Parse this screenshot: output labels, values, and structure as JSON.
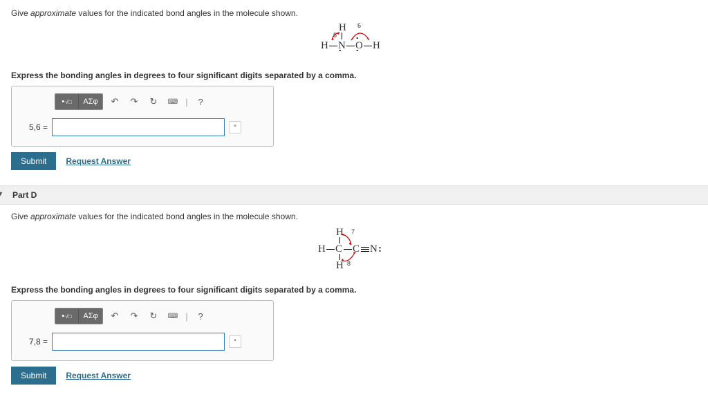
{
  "partC": {
    "instruction_prefix": "Give ",
    "instruction_em": "approximate",
    "instruction_suffix": " values for the indicated bond angles in the molecule shown.",
    "express": "Express the bonding angles in degrees to four significant digits separated by a comma.",
    "var_label": "5,6 =",
    "molecule": {
      "label5": "5",
      "label6": "6"
    }
  },
  "partD": {
    "header": "Part D",
    "instruction_prefix": "Give ",
    "instruction_em": "approximate",
    "instruction_suffix": " values for the indicated bond angles in the molecule shown.",
    "express": "Express the bonding angles in degrees to four significant digits separated by a comma.",
    "var_label": "7,8 =",
    "molecule": {
      "label7": "7",
      "label8": "8"
    }
  },
  "toolbar": {
    "templates_icon": "▪",
    "sqrt_icon": "√□",
    "greek": "ΑΣφ",
    "undo": "↶",
    "redo": "↷",
    "reset": "↻",
    "keyboard": "⌨",
    "sep": "|",
    "help": "?"
  },
  "unit": "°",
  "submit": "Submit",
  "request": "Request Answer"
}
